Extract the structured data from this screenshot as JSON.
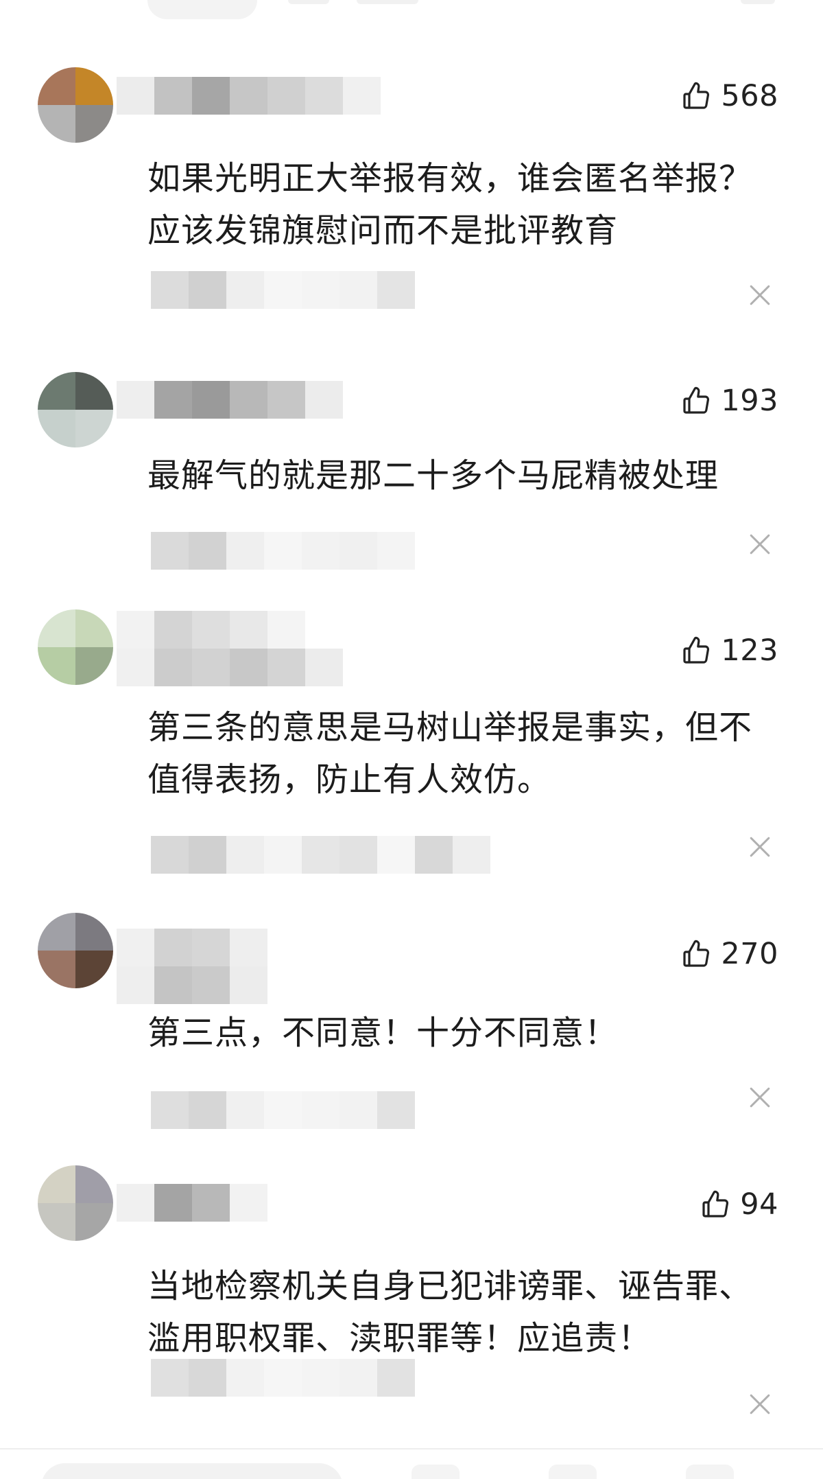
{
  "comments": [
    {
      "likes": "568",
      "text": "如果光明正大举报有效，谁会匿名举报？应该发锦旗慰问而不是批评教育",
      "avatar_colors": [
        "#a8765a",
        "#c48628",
        "#b4b4b4",
        "#8c8a88"
      ],
      "name_colors": [
        "#ececec",
        "#c2c2c2",
        "#a6a6a6",
        "#c6c6c6",
        "#d0d0d0",
        "#dcdcdc",
        "#f0f0f0"
      ],
      "meta_colors": [
        "#dcdcdc",
        "#d0d0d0",
        "#eeeeee",
        "#f6f6f6",
        "#f4f4f4",
        "#f2f2f2",
        "#e4e4e4"
      ]
    },
    {
      "likes": "193",
      "text": "最解气的就是那二十多个马屁精被处理",
      "avatar_colors": [
        "#6c7a70",
        "#555c57",
        "#c6d0cc",
        "#cdd5d2"
      ],
      "name_colors": [
        "#eeeeee",
        "#a4a4a4",
        "#9a9a9a",
        "#b8b8b8",
        "#c6c6c6",
        "#ececec"
      ],
      "meta_colors": [
        "#dadada",
        "#d2d2d2",
        "#efefef",
        "#f6f6f6",
        "#f2f2f2",
        "#f0f0f0",
        "#f4f4f4"
      ]
    },
    {
      "likes": "123",
      "text": "第三条的意思是马树山举报是事实，但不值得表扬，防止有人效仿。",
      "avatar_colors": [
        "#d8e4d0",
        "#c8d8b8",
        "#b6cda4",
        "#98aa8c"
      ],
      "name_colors": [
        "#f2f2f2",
        "#d4d4d4",
        "#dedede",
        "#e8e8e8",
        "#f4f4f4"
      ],
      "name_colors_2": [
        "#f0f0f0",
        "#cccccc",
        "#d2d2d2",
        "#c8c8c8",
        "#d4d4d4",
        "#ececec"
      ],
      "meta_colors": [
        "#d8d8d8",
        "#d0d0d0",
        "#eeeeee",
        "#f4f4f4",
        "#e6e6e6",
        "#e2e2e2",
        "#f6f6f6",
        "#d8d8d8",
        "#eeeeee"
      ]
    },
    {
      "likes": "270",
      "text": "第三点，不同意！十分不同意！",
      "avatar_colors": [
        "#a0a0a6",
        "#7c7a80",
        "#9a7464",
        "#5c4436"
      ],
      "name_colors": [
        "#f0f0f0",
        "#d2d2d2",
        "#d6d6d6",
        "#eeeeee"
      ],
      "name_colors_2": [
        "#eeeeee",
        "#c4c4c4",
        "#cacaca",
        "#ececec"
      ],
      "meta_colors": [
        "#dedede",
        "#d6d6d6",
        "#f0f0f0",
        "#f6f6f6",
        "#f4f4f4",
        "#f2f2f2",
        "#e2e2e2"
      ]
    },
    {
      "likes": "94",
      "text": "当地检察机关自身已犯诽谤罪、诬告罪、滥用职权罪、渎职罪等！应追责！",
      "avatar_colors": [
        "#d4d2c4",
        "#a09ea8",
        "#c6c6c0",
        "#a6a6a6"
      ],
      "name_colors": [
        "#f0f0f0",
        "#a4a4a4",
        "#b8b8b8",
        "#f2f2f2"
      ],
      "meta_colors": [
        "#e0e0e0",
        "#d8d8d8",
        "#f2f2f2",
        "#f6f6f6",
        "#f4f4f4",
        "#f2f2f2",
        "#e2e2e2"
      ]
    }
  ],
  "icons": {
    "like": "thumbs-up-outline-icon",
    "dismiss": "close-x-icon"
  },
  "colors": {
    "text": "#1c1c1c",
    "count": "#222222",
    "icon": "#222222",
    "close": "#b0b0b0"
  }
}
